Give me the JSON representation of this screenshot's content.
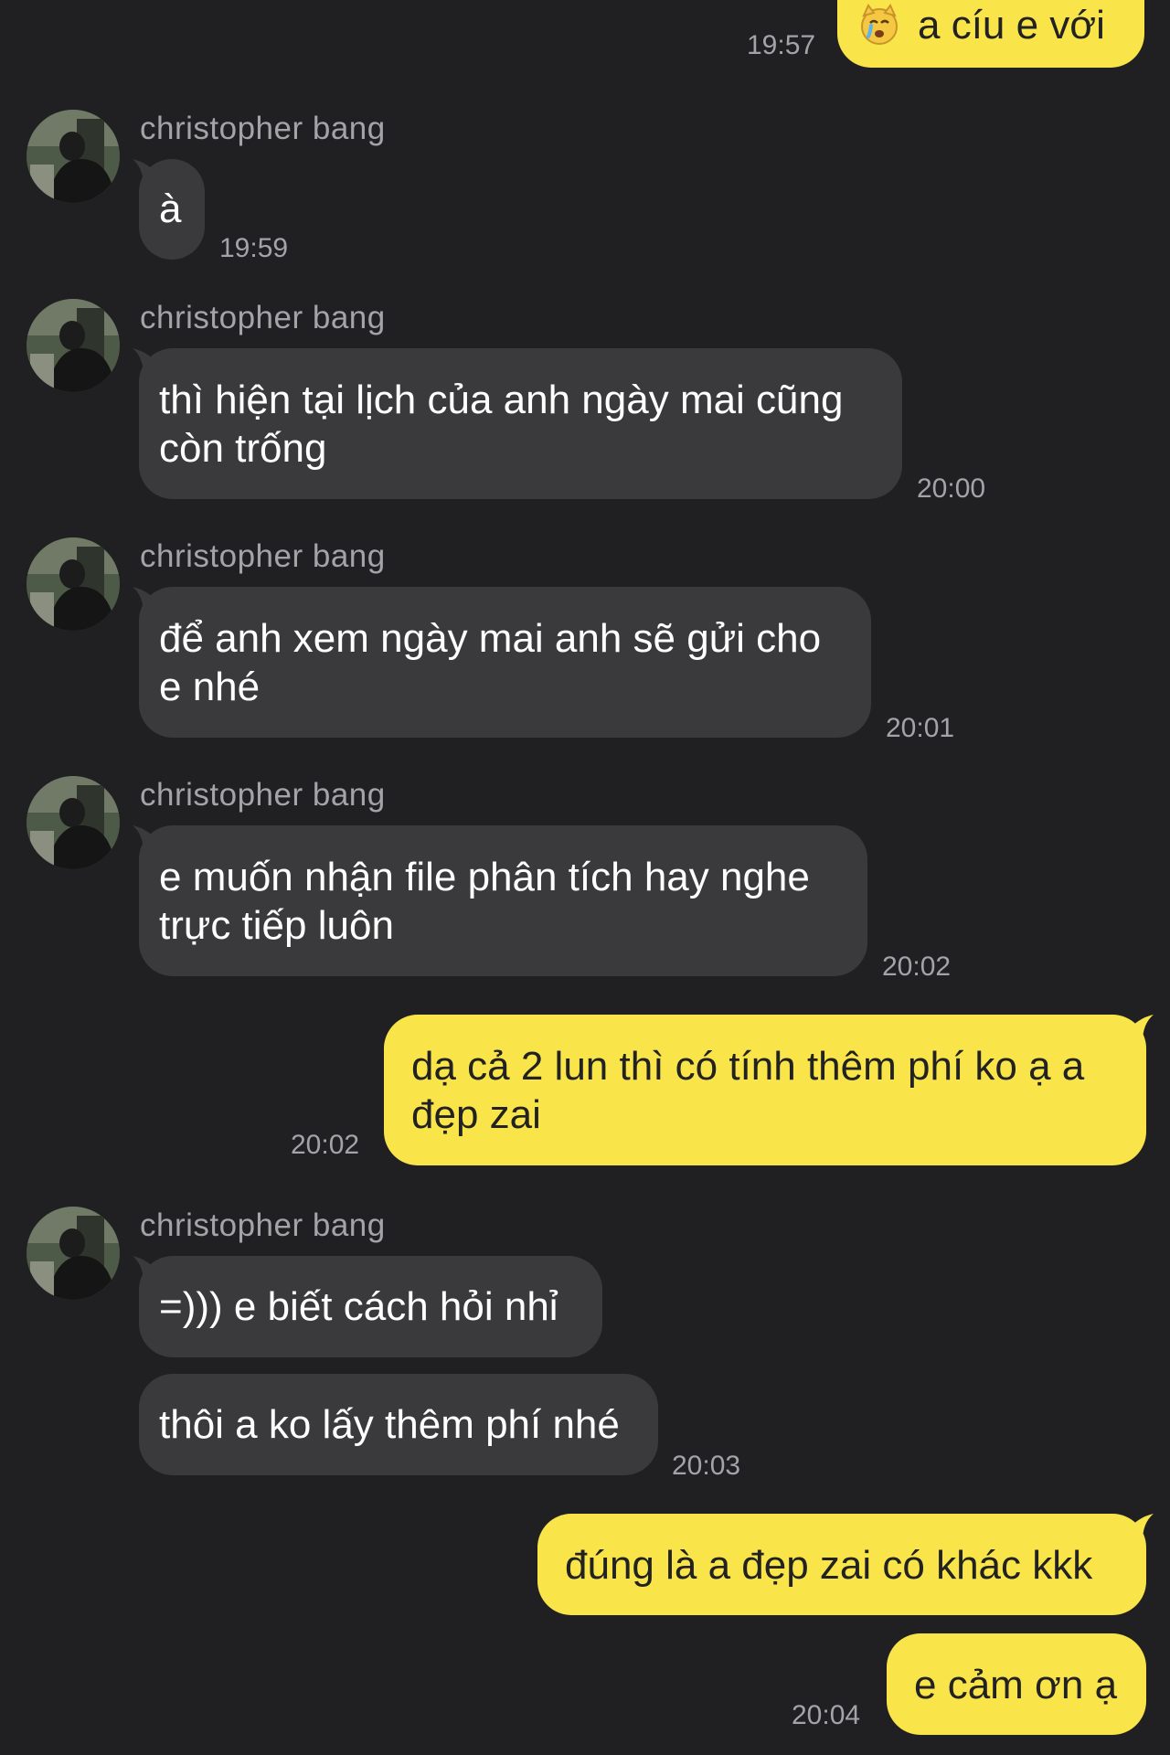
{
  "messages": [
    {
      "id": "m1",
      "dir": "out",
      "text": "a cíu e với",
      "time": "19:57",
      "emoji": "crying-cat-icon"
    },
    {
      "id": "m2",
      "dir": "in",
      "sender": "christopher bang",
      "text": "à",
      "time": "19:59"
    },
    {
      "id": "m3",
      "dir": "in",
      "sender": "christopher bang",
      "line1": "thì hiện tại lịch của anh ngày mai cũng",
      "line2": "còn trống",
      "time": "20:00"
    },
    {
      "id": "m4",
      "dir": "in",
      "sender": "christopher bang",
      "line1": "để anh xem ngày mai anh sẽ gửi cho",
      "line2": "e nhé",
      "time": "20:01"
    },
    {
      "id": "m5",
      "dir": "in",
      "sender": "christopher bang",
      "line1": "e muốn nhận file phân tích hay nghe",
      "line2": "trực tiếp luôn",
      "time": "20:02"
    },
    {
      "id": "m6",
      "dir": "out",
      "line1": "dạ cả 2 lun thì có tính thêm phí ko ạ a",
      "line2": "đẹp zai",
      "time": "20:02"
    },
    {
      "id": "m7",
      "dir": "in",
      "sender": "christopher bang",
      "text": "=))) e biết cách hỏi nhỉ"
    },
    {
      "id": "m8",
      "dir": "in",
      "text": "thôi a ko lấy thêm phí nhé",
      "time": "20:03"
    },
    {
      "id": "m9",
      "dir": "out",
      "text": "đúng là a đẹp zai có khác kkk"
    },
    {
      "id": "m10",
      "dir": "out",
      "text": "e cảm ơn ạ",
      "time": "20:04"
    }
  ],
  "colors": {
    "background": "#202022",
    "incoming": "#3a3a3c",
    "outgoing": "#f9e54a",
    "meta": "#a3a3a8"
  }
}
